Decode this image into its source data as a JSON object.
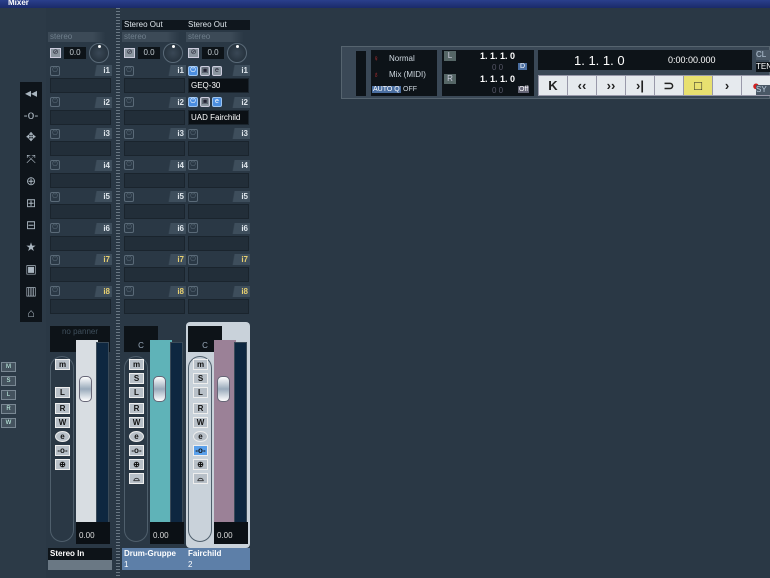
{
  "window": {
    "title": "Mixer"
  },
  "left_buttons": [
    "M",
    "S",
    "L",
    "R",
    "W"
  ],
  "tools": [
    "◂◂",
    "-o-",
    "✥",
    "⤧",
    "⊕",
    "⊞",
    "⊟",
    "★",
    "▣",
    "▥",
    "⌂"
  ],
  "channels": [
    {
      "route": "",
      "stereo_label": "stereo",
      "gain": "0.0",
      "inserts": [
        {
          "n": "i1"
        },
        {
          "n": "i2"
        },
        {
          "n": "i3"
        },
        {
          "n": "i4"
        },
        {
          "n": "i5"
        },
        {
          "n": "i6"
        },
        {
          "n": "i7"
        },
        {
          "n": "i8"
        }
      ],
      "pan": "no panner",
      "buttons": [
        "m",
        "",
        "L",
        "R",
        "W",
        "e",
        "-o-",
        "⊕"
      ],
      "fader": "0.00",
      "name": "Stereo In",
      "number": "",
      "color": "#d8dde2",
      "active": false
    },
    {
      "route": "Stereo Out",
      "stereo_label": "stereo",
      "gain": "0.0",
      "inserts": [
        {
          "n": "i1"
        },
        {
          "n": "i2"
        },
        {
          "n": "i3"
        },
        {
          "n": "i4"
        },
        {
          "n": "i5"
        },
        {
          "n": "i6"
        },
        {
          "n": "i7"
        },
        {
          "n": "i8"
        }
      ],
      "pan": "C",
      "buttons": [
        "m",
        "S",
        "L",
        "R",
        "W",
        "e",
        "-o-",
        "⊕",
        "⌓"
      ],
      "fader": "0.00",
      "name": "Drum-Gruppe",
      "number": "1",
      "color": "#5fb3b8",
      "active": false
    },
    {
      "route": "Stereo Out",
      "stereo_label": "stereo",
      "gain": "0.0",
      "inserts": [
        {
          "n": "i1",
          "plugin": "GEQ-30"
        },
        {
          "n": "i2",
          "plugin": "UAD Fairchild"
        },
        {
          "n": "i3"
        },
        {
          "n": "i4"
        },
        {
          "n": "i5"
        },
        {
          "n": "i6"
        },
        {
          "n": "i7"
        },
        {
          "n": "i8"
        }
      ],
      "pan": "C",
      "buttons": [
        "m",
        "S",
        "L",
        "R",
        "W",
        "e",
        "-o-",
        "⊕",
        "⌓"
      ],
      "fader": "0.00",
      "name": "Fairchild",
      "number": "2",
      "color": "#9b8197",
      "active": true
    }
  ],
  "transport": {
    "mode": "Normal",
    "mix": "Mix (MIDI)",
    "autoq": "AUTO Q",
    "autoq_state": "OFF",
    "left_locator": "1. 1. 1.   0",
    "right_locator": "1. 1. 1.   0",
    "left_sub": "0   0",
    "right_sub": "0   0",
    "position": "1. 1. 1.   0",
    "time": "0:00:00.000",
    "btn_l": "L",
    "btn_r": "R",
    "d": "D",
    "off": "Off",
    "click": "CL",
    "tempo": "TEN",
    "sync": "SY",
    "controls": [
      "K",
      "‹‹",
      "››",
      "›|",
      "⊃",
      "□",
      "›",
      "●"
    ]
  }
}
